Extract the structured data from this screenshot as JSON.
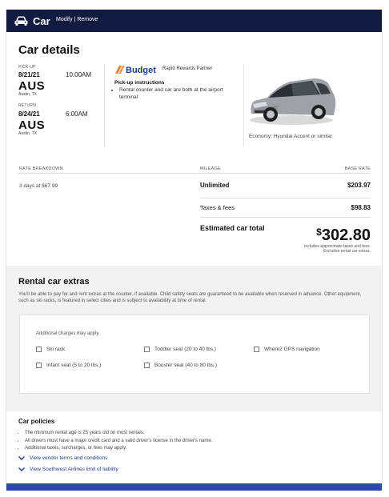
{
  "header": {
    "title": "Car",
    "modify_label": "Modify",
    "separator": " | ",
    "remove_label": "Remove",
    "icon": "car-icon"
  },
  "car_details": {
    "title": "Car details",
    "pickup": {
      "label": "PICK-UP",
      "date": "8/21/21",
      "time": "10:00AM",
      "code": "AUS",
      "city": "Austin, TX"
    },
    "return": {
      "label": "RETURN",
      "date": "8/24/21",
      "time": "6:00AM",
      "code": "AUS",
      "city": "Austin, TX"
    },
    "vendor": {
      "logo_text": "Budget",
      "partner": "Rapid Rewards Partner"
    },
    "pickup_instructions": {
      "title": "Pick-up instructions",
      "items": [
        "Rental counter and car are both at the airport terminal"
      ]
    },
    "car_description": "Economy: Hyundai Accent or similar"
  },
  "rate": {
    "headers": {
      "breakdown": "RATE BREAKDOWN",
      "mileage": "MILEAGE",
      "base_rate": "BASE RATE"
    },
    "days_text": "3 days at $67.99",
    "mileage": "Unlimited",
    "base_rate": "$203.97",
    "taxes_label": "Taxes & fees",
    "taxes_value": "$98.83",
    "total_label": "Estimated car total",
    "total_dollar": "$",
    "total_amount": "302.80",
    "total_note": "Includes approximate taxes and fees. Excludes rental car extras."
  },
  "extras": {
    "title": "Rental car extras",
    "description": "You'll be able to pay for and rent extras at the counter, if available. Child safety seats are guaranteed to be available when reserved in advance. Other equipment, such as ski racks, is featured in select cities and is subject to availability at time of rental.",
    "note": "Additional charges may apply.",
    "options": [
      "Ski rack",
      "Toddler seat (20 to 40 lbs.)",
      "Where2 GPS navigation",
      "Infant seat (5 to 20 lbs.)",
      "Booster seat (40 to 80 lbs.)"
    ]
  },
  "policies": {
    "title": "Car policies",
    "items": [
      "The minimum rental age is 25 years old on most rentals.",
      "All drivers must have a major credit card and a valid driver's license in the driver's name.",
      "Additional taxes, surcharges, or fees may apply."
    ],
    "links": [
      "View vendor terms and conditions",
      "View Southwest Airlines limit of liability"
    ]
  },
  "colors": {
    "navy": "#111b3f",
    "budget_orange": "#f47b20",
    "budget_blue": "#1a3f91",
    "link": "#1f3a8a",
    "footer_blue": "#2c4ba5"
  }
}
